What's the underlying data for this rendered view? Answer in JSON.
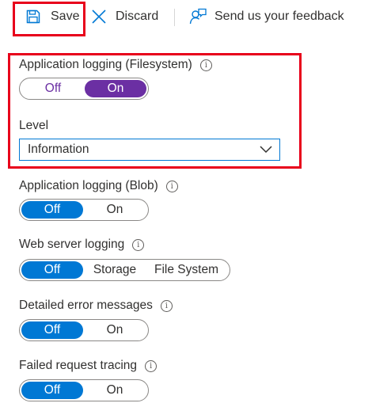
{
  "toolbar": {
    "save_label": "Save",
    "discard_label": "Discard",
    "feedback_label": "Send us your feedback"
  },
  "app_logging_fs": {
    "label": "Application logging (Filesystem)",
    "info_glyph": "i",
    "options": [
      "Off",
      "On"
    ],
    "selected": "On"
  },
  "level": {
    "label": "Level",
    "value": "Information"
  },
  "app_logging_blob": {
    "label": "Application logging (Blob)",
    "info_glyph": "i",
    "options": [
      "Off",
      "On"
    ],
    "selected": "Off"
  },
  "web_server_logging": {
    "label": "Web server logging",
    "info_glyph": "i",
    "options": [
      "Off",
      "Storage",
      "File System"
    ],
    "selected": "Off"
  },
  "detailed_errors": {
    "label": "Detailed error messages",
    "info_glyph": "i",
    "options": [
      "Off",
      "On"
    ],
    "selected": "Off"
  },
  "failed_request_tracing": {
    "label": "Failed request tracing",
    "info_glyph": "i",
    "options": [
      "Off",
      "On"
    ],
    "selected": "Off"
  },
  "colors": {
    "accent_blue": "#0078d4",
    "accent_purple": "#6b2fa3",
    "highlight_red": "#e8001b"
  },
  "icons": {
    "save": "save-icon",
    "discard": "close-icon",
    "feedback": "feedback-icon",
    "info": "info-icon",
    "dropdown": "chevron-down-icon"
  }
}
